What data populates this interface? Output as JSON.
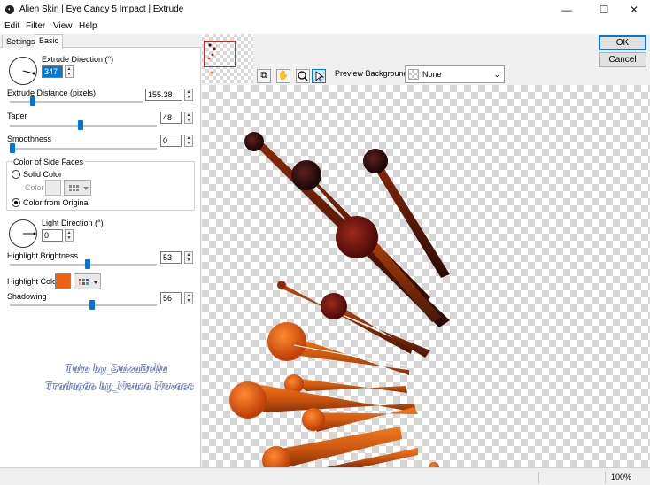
{
  "window": {
    "title": "Alien Skin | Eye Candy 5 Impact | Extrude",
    "minimize_glyph": "—",
    "maximize_glyph": "☐",
    "close_glyph": "✕"
  },
  "menu": [
    "Edit",
    "Filter",
    "View",
    "Help"
  ],
  "tabs": [
    {
      "label": "Settings",
      "active": false
    },
    {
      "label": "Basic",
      "active": true
    }
  ],
  "controls": {
    "extrude_direction": {
      "label": "Extrude Direction (°)",
      "value": "347"
    },
    "extrude_distance": {
      "label": "Extrude Distance (pixels)",
      "value": "155.38",
      "fraction": 0.15
    },
    "taper": {
      "label": "Taper",
      "value": "48",
      "fraction": 0.48
    },
    "smoothness": {
      "label": "Smoothness",
      "value": "0",
      "fraction": 0.0
    },
    "side_faces": {
      "label": "Color of Side Faces",
      "solid_color_label": "Solid Color",
      "color_label": "Color",
      "from_original_label": "Color from Original",
      "selected": "from_original"
    },
    "light_direction": {
      "label": "Light Direction (°)",
      "value": "0"
    },
    "highlight_brightness": {
      "label": "Highlight Brightness",
      "value": "53",
      "fraction": 0.53
    },
    "highlight_color": {
      "label": "Highlight Color",
      "color": "#f06010"
    },
    "shadowing": {
      "label": "Shadowing",
      "value": "56",
      "fraction": 0.56
    }
  },
  "watermark": {
    "line1": "Tuto by_SuizaBella",
    "line2": "Tradução by_Neusa Novaes"
  },
  "preview": {
    "background_label": "Preview Background:",
    "background_value": "None"
  },
  "buttons": {
    "ok": "OK",
    "cancel": "Cancel"
  },
  "status": {
    "zoom": "100%"
  },
  "colors": {
    "accent": "#0078d7",
    "highlight": "#f06010"
  }
}
